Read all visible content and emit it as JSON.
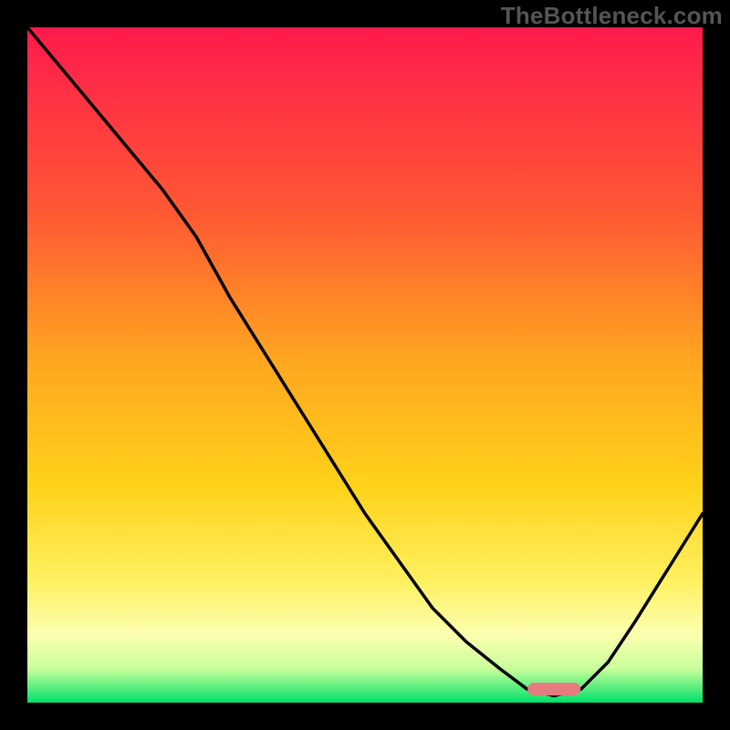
{
  "watermark": "TheBottleneck.com",
  "chart_data": {
    "type": "line",
    "title": "",
    "xlabel": "",
    "ylabel": "",
    "xlim": [
      0,
      100
    ],
    "ylim": [
      0,
      100
    ],
    "grid": false,
    "legend": false,
    "background_gradient": {
      "top": "#ff1a4d",
      "mid_upper": "#ff7a2a",
      "mid": "#ffd21a",
      "mid_lower": "#fff799",
      "bottom": "#00e06a"
    },
    "marker_at_minimum": {
      "x_approx": 78,
      "y_approx": 2,
      "color": "#e67b7f"
    },
    "series": [
      {
        "name": "curve",
        "x": [
          0,
          5,
          10,
          15,
          20,
          25,
          30,
          35,
          40,
          45,
          50,
          55,
          60,
          65,
          70,
          74,
          78,
          82,
          86,
          90,
          95,
          100
        ],
        "y": [
          100,
          94,
          88,
          82,
          76,
          69,
          60,
          52,
          44,
          36,
          28,
          21,
          14,
          9,
          5,
          2,
          1,
          2,
          6,
          12,
          20,
          28
        ]
      }
    ]
  }
}
